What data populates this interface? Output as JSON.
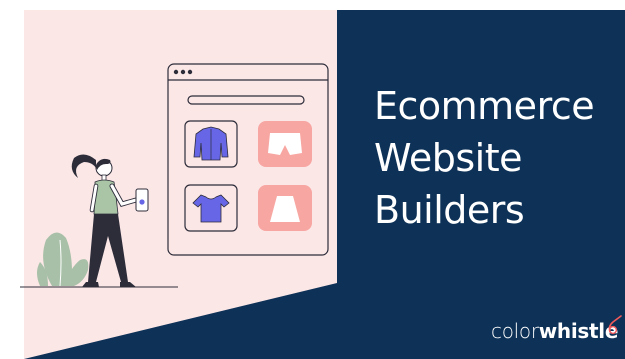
{
  "headline": {
    "line1": "Ecommerce",
    "line2": "Website",
    "line3": "Builders"
  },
  "brand": {
    "part1": "color",
    "part2": "whistle"
  },
  "colors": {
    "navy": "#0e3257",
    "blush": "#fce7e7",
    "product_blue": "#6766e6",
    "product_pink": "#f7a6a2",
    "accent_red": "#f05a5a",
    "plant_green": "#a8c0a7"
  },
  "icons": [
    "browser-window-illustration",
    "jacket-icon",
    "shorts-icon",
    "crop-top-icon",
    "skirt-icon",
    "woman-with-phone-illustration",
    "plant-illustration",
    "whistle-icon"
  ]
}
